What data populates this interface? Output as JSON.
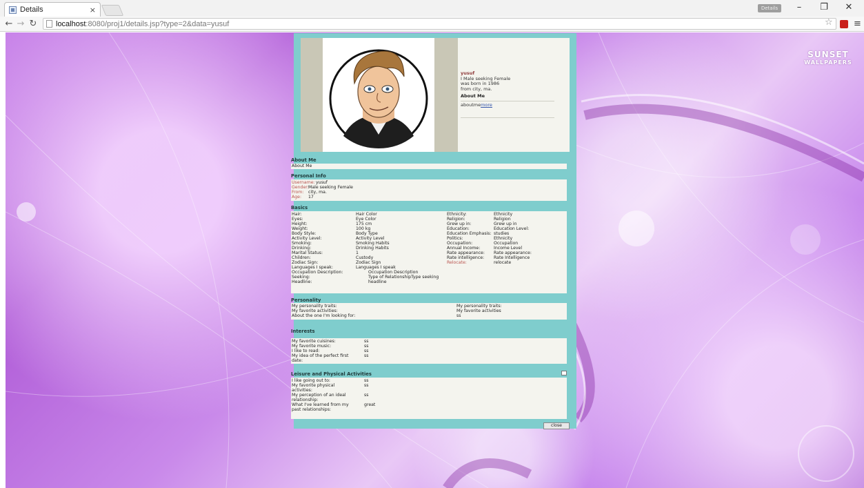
{
  "browser": {
    "tab_title": "Details",
    "tab_close": "×",
    "window_badge": "Details",
    "url_host": "localhost",
    "url_path": ":8080/proj1/details.jsp?type=2&data=yusuf"
  },
  "wallpaper": {
    "logo_line1": "SUNSET",
    "logo_line2": "WALLPAPERS"
  },
  "profile": {
    "username": "yusuf",
    "seeking": "I Male seeking Female",
    "born": "was born in 1986",
    "from": "from city, ma.",
    "about_heading": "About Me",
    "about_text": "aboutme",
    "more": "more"
  },
  "about": {
    "title": "About Me",
    "text": "About Me"
  },
  "personal": {
    "title": "Personal Info",
    "rows": [
      {
        "label": "Username:",
        "value": "yusuf"
      },
      {
        "label": "Gender:",
        "value": "Male seeking Female"
      },
      {
        "label": "From:",
        "value": "city, ma."
      },
      {
        "label": "Age:",
        "value": "17"
      }
    ]
  },
  "basics": {
    "title": "Basics",
    "left": [
      {
        "label": "Hair:",
        "value": "Hair Color"
      },
      {
        "label": "Eyes:",
        "value": "Eye Color"
      },
      {
        "label": "Height:",
        "value": "175 cm"
      },
      {
        "label": "Weight:",
        "value": "100 kg"
      },
      {
        "label": "Body Style:",
        "value": "Body Type"
      },
      {
        "label": "Activity Level:",
        "value": "Activity Level"
      },
      {
        "label": "Smoking:",
        "value": "Smoking Habits"
      },
      {
        "label": "Drinking:",
        "value": "Drinking Habits"
      },
      {
        "label": "Marital Status:",
        "value": "1"
      },
      {
        "label": "Children:",
        "value": "Custody"
      },
      {
        "label": "Zodiac Sign:",
        "value": "Zodiac Sign"
      },
      {
        "label": "Languages I speak:",
        "value": "Languages I speak"
      }
    ],
    "bottom": [
      {
        "label": "Occupation Description:",
        "value": "Occupation Description"
      },
      {
        "label": "Seeking:",
        "value": "Type of RelationshipType seeking"
      },
      {
        "label": "Headline:",
        "value": "headline"
      }
    ],
    "right": [
      {
        "label": "Ethnicity:",
        "value": "Ethnicity"
      },
      {
        "label": "Religion:",
        "value": "Religion"
      },
      {
        "label": "Grew up in:",
        "value": "Grew up in"
      },
      {
        "label": "Education:",
        "value": "Education Level:"
      },
      {
        "label": "Education Emphasis:",
        "value": "studies"
      },
      {
        "label": "Politics:",
        "value": "Ethnicity"
      },
      {
        "label": "Occupation:",
        "value": "Occupation"
      },
      {
        "label": "Annual Income:",
        "value": "Income Level"
      },
      {
        "label": "Rate appearance:",
        "value": "Rate appearance:"
      },
      {
        "label": "Rate intelligence:",
        "value": "Rate Intelligence"
      },
      {
        "label": "Relocate:",
        "value": "relocate"
      }
    ]
  },
  "personality": {
    "title": "Personality",
    "left": [
      "My personality traits:",
      "My favorite activities:",
      "About the one I'm looking for:"
    ],
    "right": [
      "My personality traits:",
      "My favorite activities",
      "ss"
    ]
  },
  "interests": {
    "title": "Interests",
    "rows": [
      {
        "label": "My favorite cuisines:",
        "value": "ss"
      },
      {
        "label": "My favorite music:",
        "value": "ss"
      },
      {
        "label": "I like to read:",
        "value": "ss"
      },
      {
        "label": "My idea of the perfect first",
        "value": "ss"
      },
      {
        "label": "date:",
        "value": ""
      }
    ]
  },
  "leisure": {
    "title": "Leisure and Physical Activities",
    "rows": [
      {
        "label": "I like going out to:",
        "value": "ss"
      },
      {
        "label": "My favorite physical",
        "value": "ss"
      },
      {
        "label": "activities:",
        "value": ""
      },
      {
        "label": "My perception of an ideal",
        "value": "ss"
      },
      {
        "label": "relationship:",
        "value": ""
      },
      {
        "label": "What I've learned from my",
        "value": "great"
      },
      {
        "label": "past relationships:",
        "value": ""
      }
    ]
  },
  "close_label": "close",
  "colors": {
    "panel": "#7fcdcd",
    "box": "#f4f4ee",
    "accent_red": "#b9524d"
  }
}
